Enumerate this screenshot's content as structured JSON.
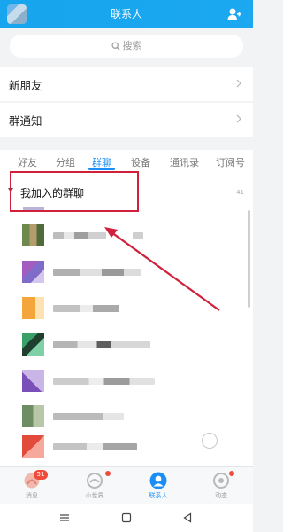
{
  "header": {
    "title": "联系人"
  },
  "search": {
    "placeholder": "搜索"
  },
  "rows": [
    {
      "label": "新朋友"
    },
    {
      "label": "群通知"
    }
  ],
  "tabs": [
    {
      "label": "好友"
    },
    {
      "label": "分组"
    },
    {
      "label": "群聊",
      "active": true
    },
    {
      "label": "设备"
    },
    {
      "label": "通讯录"
    },
    {
      "label": "订阅号"
    }
  ],
  "group": {
    "title": "我加入的群聊",
    "count": "41"
  },
  "bottom_nav": [
    {
      "label": "消息",
      "badge": "51"
    },
    {
      "label": "小世界"
    },
    {
      "label": "联系人",
      "active": true
    },
    {
      "label": "动态"
    }
  ],
  "colors": {
    "accent": "#1a8ef5",
    "header": "#16a5ee",
    "annotation": "#d0203a",
    "badge": "#f04a3c"
  },
  "icons": {
    "header": [
      "avatar",
      "add-friend-icon"
    ],
    "search": "search-icon",
    "rows": "chevron-right-icon",
    "system": [
      "menu-icon",
      "home-icon",
      "back-icon"
    ]
  }
}
